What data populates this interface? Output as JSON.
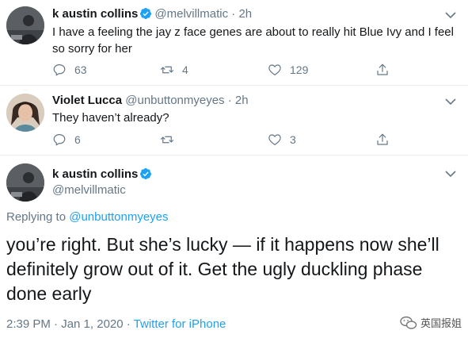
{
  "tweets": [
    {
      "name": "k austin collins",
      "handle": "@melvillmatic",
      "time": "2h",
      "text_lines": [
        "I have a feeling the jay z face genes are about to really hit Blue Ivy and I feel",
        "so sorry for her"
      ],
      "reply_count": "63",
      "retweet_count": "4",
      "like_count": "129"
    },
    {
      "name": "Violet Lucca",
      "handle": "@unbuttonmyeyes",
      "time": "2h",
      "text_lines": [
        "They haven’t already?"
      ],
      "reply_count": "6",
      "retweet_count": "",
      "like_count": "3"
    }
  ],
  "focused": {
    "name": "k austin collins",
    "handle": "@melvillmatic",
    "replying_prefix": "Replying to",
    "replying_to": "@unbuttonmyeyes",
    "text_lines": [
      "you’re right. But she’s lucky — if it happens now she’ll",
      "definitely grow out of it. Get the ugly duckling phase",
      "done early"
    ],
    "timestamp": "2:39 PM · Jan 1, 2020 · ",
    "source": "Twitter for iPhone"
  },
  "watermark": {
    "text": "英国报姐"
  },
  "separator": " · ",
  "colors": {
    "accent": "#1da1f2",
    "muted": "#657786",
    "text": "#14171a"
  }
}
